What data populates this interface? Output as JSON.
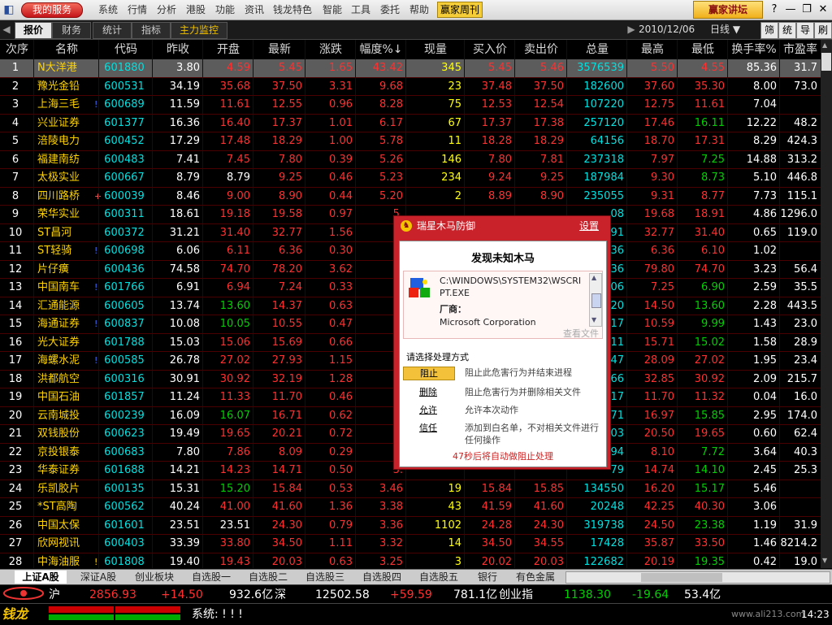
{
  "menubar": {
    "my_service": "我的服务",
    "items": [
      "系统",
      "行情",
      "分析",
      "港股",
      "功能",
      "资讯",
      "钱龙特色",
      "智能",
      "工具",
      "委托",
      "帮助"
    ],
    "weekly": "赢家周刊",
    "yingjia": "赢家讲坛",
    "help_glyph": "?",
    "min_glyph": "—",
    "restore_glyph": "❐",
    "close_glyph": "✕"
  },
  "tabbar": {
    "tabs": [
      "报价",
      "财务",
      "统计",
      "指标",
      "主力监控"
    ],
    "date": "2010/12/06",
    "period": "日线 ▼",
    "tools": [
      "筛",
      "统",
      "导",
      "刷"
    ]
  },
  "columns": [
    "次序",
    "名称",
    "代码",
    "昨收",
    "开盘",
    "最新",
    "涨跌",
    "幅度%↓",
    "现量",
    "买入价",
    "卖出价",
    "总量",
    "最高",
    "最低",
    "换手率%",
    "市盈率"
  ],
  "rows": [
    [
      "1",
      "N大洋港",
      "601880",
      "3.80",
      "4.59",
      "5.45",
      "1.65",
      "43.42",
      "345",
      "5.45",
      "5.46",
      "3576539",
      "5.50",
      "4.55",
      "85.36",
      "31.7"
    ],
    [
      "2",
      "豫光金铅",
      "600531",
      "34.19",
      "35.68",
      "37.50",
      "3.31",
      "9.68",
      "23",
      "37.48",
      "37.50",
      "182600",
      "37.60",
      "35.30",
      "8.00",
      "73.0"
    ],
    [
      "3",
      "上海三毛",
      "600689",
      "11.59",
      "11.61",
      "12.55",
      "0.96",
      "8.28",
      "75",
      "12.53",
      "12.54",
      "107220",
      "12.75",
      "11.61",
      "7.04",
      ""
    ],
    [
      "4",
      "兴业证券",
      "601377",
      "16.36",
      "16.40",
      "17.37",
      "1.01",
      "6.17",
      "67",
      "17.37",
      "17.38",
      "257120",
      "17.46",
      "16.11",
      "12.22",
      "48.2"
    ],
    [
      "5",
      "涪陵电力",
      "600452",
      "17.29",
      "17.48",
      "18.29",
      "1.00",
      "5.78",
      "11",
      "18.28",
      "18.29",
      "64156",
      "18.70",
      "17.31",
      "8.29",
      "424.3"
    ],
    [
      "6",
      "福建南纺",
      "600483",
      "7.41",
      "7.45",
      "7.80",
      "0.39",
      "5.26",
      "146",
      "7.80",
      "7.81",
      "237318",
      "7.97",
      "7.25",
      "14.88",
      "313.2"
    ],
    [
      "7",
      "太极实业",
      "600667",
      "8.79",
      "8.79",
      "9.25",
      "0.46",
      "5.23",
      "234",
      "9.24",
      "9.25",
      "187984",
      "9.30",
      "8.73",
      "5.10",
      "446.8"
    ],
    [
      "8",
      "四川路桥",
      "600039",
      "8.46",
      "9.00",
      "8.90",
      "0.44",
      "5.20",
      "2",
      "8.89",
      "8.90",
      "235055",
      "9.31",
      "8.77",
      "7.73",
      "115.1"
    ],
    [
      "9",
      "荣华实业",
      "600311",
      "18.61",
      "19.18",
      "19.58",
      "0.97",
      "5.",
      "",
      "",
      "",
      "08",
      "19.68",
      "18.91",
      "4.86",
      "1296.0"
    ],
    [
      "10",
      "ST昌河",
      "600372",
      "31.21",
      "31.40",
      "32.77",
      "1.56",
      "5.",
      "",
      "",
      "",
      "91",
      "32.77",
      "31.40",
      "0.65",
      "119.0"
    ],
    [
      "11",
      "ST轻骑",
      "600698",
      "6.06",
      "6.11",
      "6.36",
      "0.30",
      "4.",
      "",
      "",
      "",
      "36",
      "6.36",
      "6.10",
      "1.02",
      ""
    ],
    [
      "12",
      "片仔癀",
      "600436",
      "74.58",
      "74.70",
      "78.20",
      "3.62",
      "4.",
      "",
      "",
      "",
      "36",
      "79.80",
      "74.70",
      "3.23",
      "56.4"
    ],
    [
      "13",
      "中国南车",
      "601766",
      "6.91",
      "6.94",
      "7.24",
      "0.33",
      "4.",
      "",
      "",
      "",
      "06",
      "7.25",
      "6.90",
      "2.59",
      "35.5"
    ],
    [
      "14",
      "汇通能源",
      "600605",
      "13.74",
      "13.60",
      "14.37",
      "0.63",
      "4.",
      "",
      "",
      "",
      "20",
      "14.50",
      "13.60",
      "2.28",
      "443.5"
    ],
    [
      "15",
      "海通证券",
      "600837",
      "10.08",
      "10.05",
      "10.55",
      "0.47",
      "4.",
      "",
      "",
      "",
      "17",
      "10.59",
      "9.99",
      "1.43",
      "23.0"
    ],
    [
      "16",
      "光大证券",
      "601788",
      "15.03",
      "15.06",
      "15.69",
      "0.66",
      "4.",
      "",
      "",
      "",
      "11",
      "15.71",
      "15.02",
      "1.58",
      "28.9"
    ],
    [
      "17",
      "海螺水泥",
      "600585",
      "26.78",
      "27.02",
      "27.93",
      "1.15",
      "4.",
      "",
      "",
      "",
      "47",
      "28.09",
      "27.02",
      "1.95",
      "23.4"
    ],
    [
      "18",
      "洪都航空",
      "600316",
      "30.91",
      "30.92",
      "32.19",
      "1.28",
      "4.",
      "",
      "",
      "",
      "66",
      "32.85",
      "30.92",
      "2.09",
      "215.7"
    ],
    [
      "19",
      "中国石油",
      "601857",
      "11.24",
      "11.33",
      "11.70",
      "0.46",
      "4.",
      "",
      "",
      "",
      "17",
      "11.70",
      "11.32",
      "0.04",
      "16.0"
    ],
    [
      "20",
      "云南城投",
      "600239",
      "16.09",
      "16.07",
      "16.71",
      "0.62",
      "3.",
      "",
      "",
      "",
      "71",
      "16.97",
      "15.85",
      "2.95",
      "174.0"
    ],
    [
      "21",
      "双钱股份",
      "600623",
      "19.49",
      "19.65",
      "20.21",
      "0.72",
      "3.",
      "",
      "",
      "",
      "03",
      "20.50",
      "19.65",
      "0.60",
      "62.4"
    ],
    [
      "22",
      "京投银泰",
      "600683",
      "7.80",
      "7.86",
      "8.09",
      "0.29",
      "3.",
      "",
      "",
      "",
      "94",
      "8.10",
      "7.72",
      "3.64",
      "40.3"
    ],
    [
      "23",
      "华泰证券",
      "601688",
      "14.21",
      "14.23",
      "14.71",
      "0.50",
      "3.",
      "",
      "",
      "",
      "79",
      "14.74",
      "14.10",
      "2.45",
      "25.3"
    ],
    [
      "24",
      "乐凯胶片",
      "600135",
      "15.31",
      "15.20",
      "15.84",
      "0.53",
      "3.46",
      "19",
      "15.84",
      "15.85",
      "134550",
      "16.20",
      "15.17",
      "5.46",
      ""
    ],
    [
      "25",
      "*ST高陶",
      "600562",
      "40.24",
      "41.00",
      "41.60",
      "1.36",
      "3.38",
      "43",
      "41.59",
      "41.60",
      "20248",
      "42.25",
      "40.30",
      "3.06",
      ""
    ],
    [
      "26",
      "中国太保",
      "601601",
      "23.51",
      "23.51",
      "24.30",
      "0.79",
      "3.36",
      "1102",
      "24.28",
      "24.30",
      "319738",
      "24.50",
      "23.38",
      "1.19",
      "31.9"
    ],
    [
      "27",
      "欣网视讯",
      "600403",
      "33.39",
      "33.80",
      "34.50",
      "1.11",
      "3.32",
      "14",
      "34.50",
      "34.55",
      "17428",
      "35.87",
      "33.50",
      "1.46",
      "8214.2"
    ],
    [
      "28",
      "中海油服",
      "601808",
      "19.40",
      "19.43",
      "20.03",
      "0.63",
      "3.25",
      "3",
      "20.02",
      "20.03",
      "122682",
      "20.19",
      "19.35",
      "0.42",
      "19.0"
    ]
  ],
  "row_marks": {
    "3": "!",
    "8": "+",
    "11": "!",
    "13": "!",
    "15": "!",
    "17": "!",
    "28": "!"
  },
  "bottom_tabs": [
    "上证A股",
    "深证A股",
    "创业板块",
    "自选股一",
    "自选股二",
    "自选股三",
    "自选股四",
    "自选股五",
    "银行",
    "有色金属"
  ],
  "indices": [
    {
      "name": "沪",
      "value": "2856.93",
      "change": "+14.50",
      "amount": "932.6亿"
    },
    {
      "name": "深",
      "value": "12502.58",
      "change": "+59.59",
      "amount": "781.1亿"
    },
    {
      "name": "创业指",
      "value": "1138.30",
      "change": "-19.64",
      "amount": "53.4亿"
    }
  ],
  "status": {
    "brand": "钱龙",
    "message": "系统: ! ! !",
    "time": "14:23",
    "watermark": "www.ali213.com"
  },
  "popup": {
    "title": "瑞星木马防御",
    "settings": "设置",
    "heading": "发现未知木马",
    "file_path": "C:\\WINDOWS\\SYSTEM32\\WSCRIPT.EXE",
    "vendor_label": "厂商：",
    "vendor": "Microsoft Corporation",
    "view_file": "查看文件",
    "choose": "请选择处理方式",
    "options": [
      {
        "action": "阻止",
        "desc": "阻止此危害行为并结束进程"
      },
      {
        "action": "删除",
        "desc": "阻止危害行为并删除相关文件"
      },
      {
        "action": "允许",
        "desc": "允许本次动作"
      },
      {
        "action": "信任",
        "desc": "添加到白名单，不对相关文件进行任何操作"
      }
    ],
    "countdown": "47秒后将自动做阻止处理"
  },
  "colors": {
    "up": "#ff3030",
    "down": "#00d000",
    "flat": "#ffffff",
    "name": "#ffd400",
    "code": "#00e0e0",
    "volume": "#ffff00",
    "total": "#00e0e0",
    "bg": "#000000",
    "selected": "#5c5c5c"
  }
}
